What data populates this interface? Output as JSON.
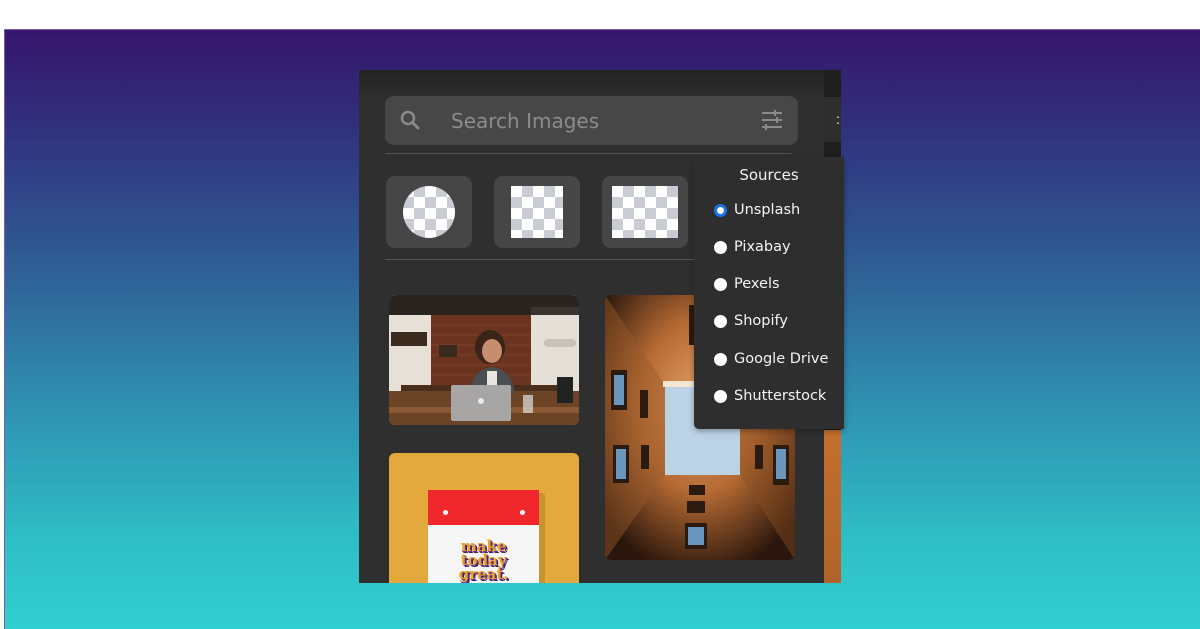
{
  "search": {
    "placeholder": "Search Images",
    "value": "",
    "icon": "search-icon",
    "filter_icon": "sliders-icon"
  },
  "side_tab": {
    "label": ":"
  },
  "shapes": [
    {
      "name": "circle-shape",
      "kind": "circle"
    },
    {
      "name": "square-shape",
      "kind": "square"
    },
    {
      "name": "rectangle-shape",
      "kind": "rectangle"
    }
  ],
  "images": [
    {
      "name": "man-with-laptop-photo",
      "description": "Smiling man with laptop in cafe"
    },
    {
      "name": "building-courtyard-photo",
      "description": "Looking up through building courtyard"
    },
    {
      "name": "make-today-great-calendar",
      "description": "Calendar with text",
      "text": [
        "make",
        "today",
        "great."
      ]
    }
  ],
  "sources_popover": {
    "title": "Sources",
    "selected": "Unsplash",
    "options": [
      {
        "label": "Unsplash",
        "checked": true
      },
      {
        "label": "Pixabay",
        "checked": false
      },
      {
        "label": "Pexels",
        "checked": false
      },
      {
        "label": "Shopify",
        "checked": false
      },
      {
        "label": "Google Drive",
        "checked": false
      },
      {
        "label": "Shutterstock",
        "checked": false
      }
    ]
  },
  "colors": {
    "panel": "#2f2f2f",
    "search_bg": "#474747",
    "tile_bg": "#464646",
    "radio_selected": "#1a73e8",
    "gradient_top": "#36156b",
    "gradient_bottom": "#30cfd0"
  }
}
